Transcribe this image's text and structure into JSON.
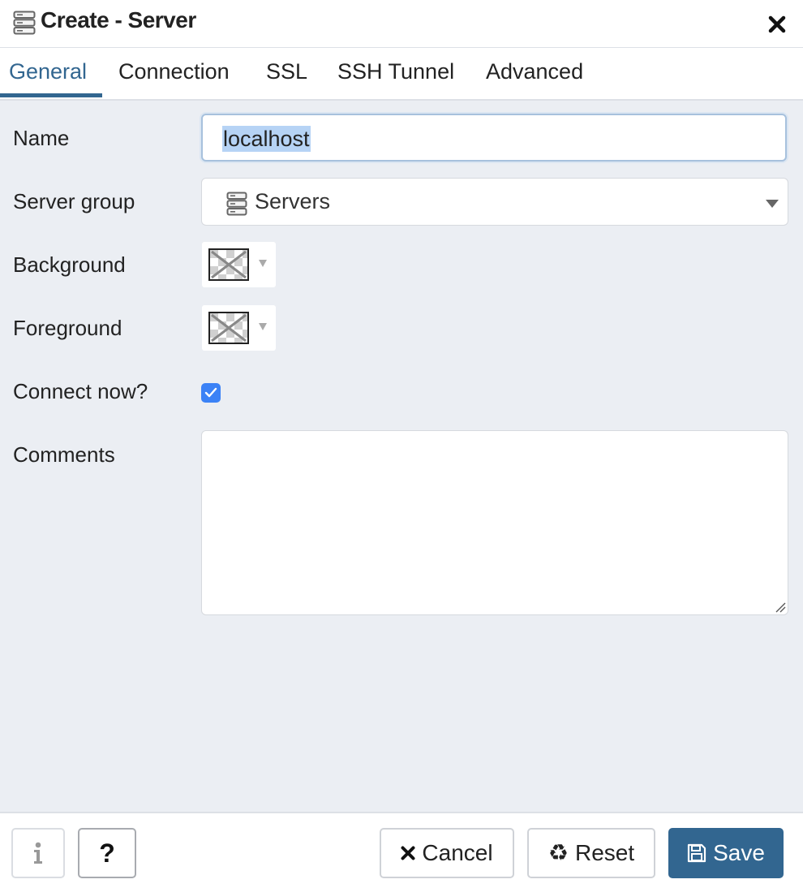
{
  "dialog": {
    "title": "Create - Server",
    "title_icon": "server-icon",
    "close_icon": "close-icon"
  },
  "tabs": [
    {
      "label": "General",
      "active": true
    },
    {
      "label": "Connection",
      "active": false
    },
    {
      "label": "SSL",
      "active": false
    },
    {
      "label": "SSH Tunnel",
      "active": false
    },
    {
      "label": "Advanced",
      "active": false
    }
  ],
  "form": {
    "name": {
      "label": "Name",
      "value": "localhost"
    },
    "server_group": {
      "label": "Server group",
      "value": "Servers",
      "icon": "server-icon"
    },
    "background": {
      "label": "Background"
    },
    "foreground": {
      "label": "Foreground"
    },
    "connect_now": {
      "label": "Connect now?",
      "checked": true
    },
    "comments": {
      "label": "Comments",
      "value": ""
    }
  },
  "footer": {
    "info_icon": "info-icon",
    "help_label": "?",
    "cancel_label": "Cancel",
    "reset_label": "Reset",
    "save_label": "Save"
  },
  "colors": {
    "accent": "#326690",
    "checkbox": "#3b82f6",
    "selection": "#b6d3f5",
    "panel_bg": "#ebeef3"
  }
}
